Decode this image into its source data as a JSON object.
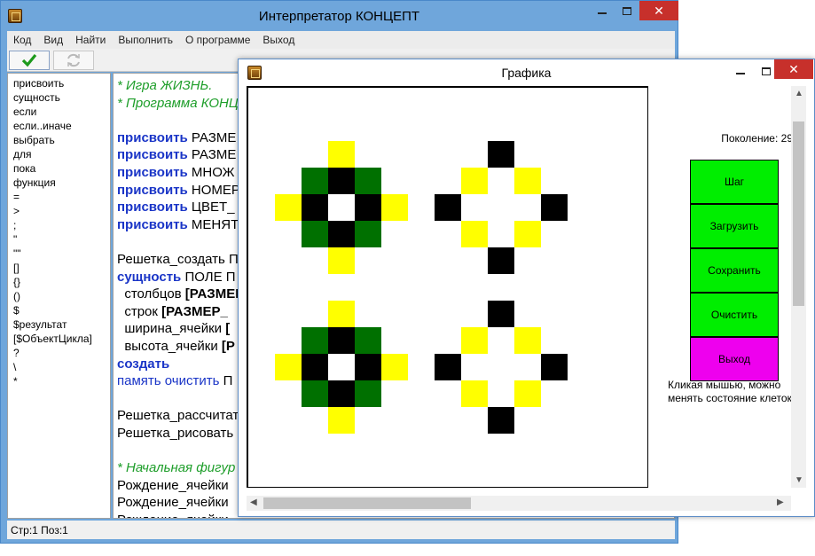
{
  "main_window": {
    "title": "Интерпретатор КОНЦЕПТ",
    "menu": [
      "Код",
      "Вид",
      "Найти",
      "Выполнить",
      "О программе",
      "Выход"
    ],
    "keywords": [
      "присвоить",
      "сущность",
      "если",
      "если..иначе",
      "выбрать",
      "для",
      "пока",
      "функция",
      "=",
      ">",
      ";",
      "\"",
      "\"\"",
      "[]",
      "{}",
      "()",
      "$",
      "$результат",
      "[$ОбъектЦикла]",
      "?",
      "\\",
      "*"
    ],
    "code_lines": [
      {
        "segs": [
          {
            "t": "* Игра ЖИЗНЬ.",
            "s": "comment"
          }
        ]
      },
      {
        "segs": [
          {
            "t": "* Программа КОНЦ",
            "s": "comment"
          }
        ]
      },
      {
        "segs": []
      },
      {
        "segs": [
          {
            "t": "присвоить",
            "s": "kw"
          },
          {
            "t": " РАЗМЕ",
            "s": "plain"
          }
        ]
      },
      {
        "segs": [
          {
            "t": "присвоить",
            "s": "kw"
          },
          {
            "t": " РАЗМЕ",
            "s": "plain"
          }
        ]
      },
      {
        "segs": [
          {
            "t": "присвоить",
            "s": "kw"
          },
          {
            "t": " МНОЖ",
            "s": "plain"
          }
        ]
      },
      {
        "segs": [
          {
            "t": "присвоить",
            "s": "kw"
          },
          {
            "t": " НОМЕР",
            "s": "plain"
          }
        ]
      },
      {
        "segs": [
          {
            "t": "присвоить",
            "s": "kw"
          },
          {
            "t": " ЦВЕТ_",
            "s": "plain"
          }
        ]
      },
      {
        "segs": [
          {
            "t": "присвоить",
            "s": "kw"
          },
          {
            "t": " МЕНЯТ",
            "s": "plain"
          }
        ]
      },
      {
        "segs": []
      },
      {
        "segs": [
          {
            "t": "Решетка_создать П",
            "s": "plain"
          }
        ]
      },
      {
        "segs": [
          {
            "t": "сущность",
            "s": "kw"
          },
          {
            "t": " ПОЛЕ П",
            "s": "plain"
          }
        ]
      },
      {
        "segs": [
          {
            "t": "  столбцов ",
            "s": "plain"
          },
          {
            "t": "[РАЗМЕР",
            "s": "bold"
          }
        ]
      },
      {
        "segs": [
          {
            "t": "  строк ",
            "s": "plain"
          },
          {
            "t": "[РАЗМЕР_",
            "s": "bold"
          }
        ]
      },
      {
        "segs": [
          {
            "t": "  ширина_ячейки ",
            "s": "plain"
          },
          {
            "t": "[",
            "s": "bold"
          }
        ]
      },
      {
        "segs": [
          {
            "t": "  высота_ячейки ",
            "s": "plain"
          },
          {
            "t": "[Р",
            "s": "bold"
          }
        ]
      },
      {
        "segs": [
          {
            "t": "создать",
            "s": "kw"
          }
        ]
      },
      {
        "segs": [
          {
            "t": "память очистить",
            "s": "kw2"
          },
          {
            "t": " П",
            "s": "plain"
          }
        ]
      },
      {
        "segs": []
      },
      {
        "segs": [
          {
            "t": "Решетка_рассчитат",
            "s": "plain"
          }
        ]
      },
      {
        "segs": [
          {
            "t": "Решетка_рисовать",
            "s": "plain"
          }
        ]
      },
      {
        "segs": []
      },
      {
        "segs": [
          {
            "t": "* Начальная фигур",
            "s": "comment"
          }
        ]
      },
      {
        "segs": [
          {
            "t": "Рождение_ячейки",
            "s": "plain"
          }
        ]
      },
      {
        "segs": [
          {
            "t": "Рождение_ячейки",
            "s": "plain"
          }
        ]
      },
      {
        "segs": [
          {
            "t": "Рождение_ячейки",
            "s": "plain"
          }
        ]
      }
    ],
    "status": "Стр:1 Поз:1"
  },
  "graphics_window": {
    "title": "Графика",
    "generation_label": "Поколение: 29",
    "buttons": [
      {
        "label": "Шаг",
        "color": "#00ee00"
      },
      {
        "label": "Загрузить",
        "color": "#00ee00"
      },
      {
        "label": "Сохранить",
        "color": "#00ee00"
      },
      {
        "label": "Очистить",
        "color": "#00ee00"
      },
      {
        "label": "Выход",
        "color": "#ee00ee"
      }
    ],
    "hint": "Кликая мышью, можно менять состояние клеток.",
    "grid": {
      "cols": 15,
      "rows": 15,
      "colors": {
        "K": "#000000",
        "G": "#007000",
        "Y": "#ffff00"
      },
      "cells": [
        "...............",
        "...............",
        "...Y.....K.....",
        "..GKG...Y.Y....",
        ".YK.KY.K...K...",
        "..GKG...Y.Y....",
        "...Y.....K.....",
        "...............",
        "...Y.....K.....",
        "..GKG...Y.Y....",
        ".YK.KY.K...K...",
        "..GKG...Y.Y....",
        "...Y.....K.....",
        "...............",
        "..............."
      ]
    }
  }
}
